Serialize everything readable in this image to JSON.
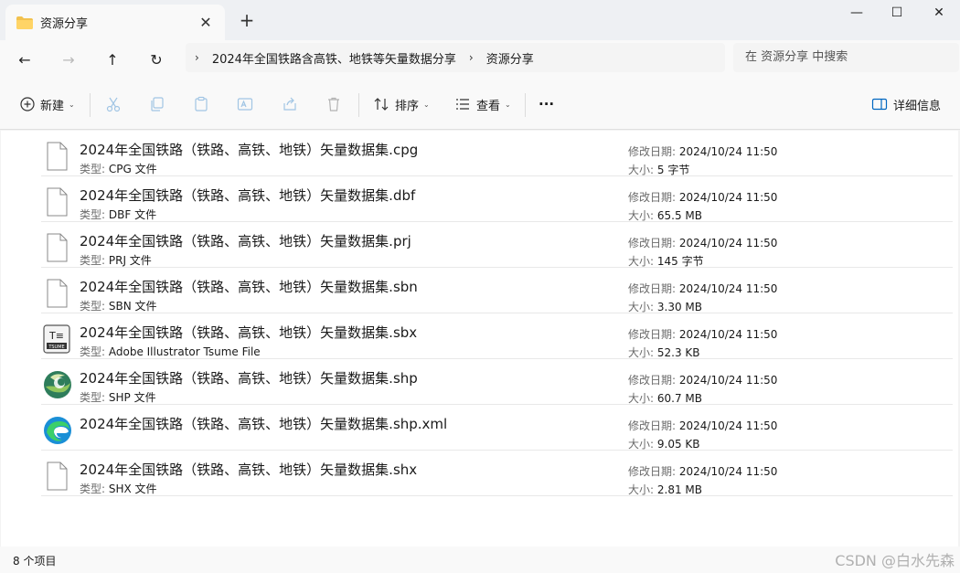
{
  "window": {
    "tab_title": "资源分享",
    "tab_close": "✕",
    "new_tab": "+",
    "minimize": "—",
    "maximize": "☐",
    "close": "✕"
  },
  "nav": {
    "back": "←",
    "forward": "→",
    "up": "↑",
    "refresh": "↻"
  },
  "address": {
    "chevron": "›",
    "breadcrumbs": [
      "2024年全国铁路含高铁、地铁等矢量数据分享",
      "资源分享"
    ]
  },
  "search": {
    "placeholder": "在 资源分享 中搜索"
  },
  "toolbar": {
    "new_label": "新建",
    "sort_label": "排序",
    "view_label": "查看",
    "more_label": "···",
    "details_label": "详细信息",
    "chevron": "⌄"
  },
  "files": [
    {
      "name": "2024年全国铁路（铁路、高铁、地铁）矢量数据集.cpg",
      "type_key": "类型:",
      "type": "CPG 文件",
      "icon": "generic-file-icon",
      "date_key": "修改日期:",
      "date": "2024/10/24 11:50",
      "size_key": "大小:",
      "size": "5 字节"
    },
    {
      "name": "2024年全国铁路（铁路、高铁、地铁）矢量数据集.dbf",
      "type_key": "类型:",
      "type": "DBF 文件",
      "icon": "generic-file-icon",
      "date_key": "修改日期:",
      "date": "2024/10/24 11:50",
      "size_key": "大小:",
      "size": "65.5 MB"
    },
    {
      "name": "2024年全国铁路（铁路、高铁、地铁）矢量数据集.prj",
      "type_key": "类型:",
      "type": "PRJ 文件",
      "icon": "generic-file-icon",
      "date_key": "修改日期:",
      "date": "2024/10/24 11:50",
      "size_key": "大小:",
      "size": "145 字节"
    },
    {
      "name": "2024年全国铁路（铁路、高铁、地铁）矢量数据集.sbn",
      "type_key": "类型:",
      "type": "SBN 文件",
      "icon": "generic-file-icon",
      "date_key": "修改日期:",
      "date": "2024/10/24 11:50",
      "size_key": "大小:",
      "size": "3.30 MB"
    },
    {
      "name": "2024年全国铁路（铁路、高铁、地铁）矢量数据集.sbx",
      "type_key": "类型:",
      "type": "Adobe Illustrator Tsume File",
      "icon": "tsume-file-icon",
      "date_key": "修改日期:",
      "date": "2024/10/24 11:50",
      "size_key": "大小:",
      "size": "52.3 KB"
    },
    {
      "name": "2024年全国铁路（铁路、高铁、地铁）矢量数据集.shp",
      "type_key": "类型:",
      "type": "SHP 文件",
      "icon": "globe-file-icon",
      "date_key": "修改日期:",
      "date": "2024/10/24 11:50",
      "size_key": "大小:",
      "size": "60.7 MB"
    },
    {
      "name": "2024年全国铁路（铁路、高铁、地铁）矢量数据集.shp.xml",
      "type_key": "",
      "type": "",
      "icon": "edge-browser-icon",
      "date_key": "修改日期:",
      "date": "2024/10/24 11:50",
      "size_key": "大小:",
      "size": "9.05 KB"
    },
    {
      "name": "2024年全国铁路（铁路、高铁、地铁）矢量数据集.shx",
      "type_key": "类型:",
      "type": "SHX 文件",
      "icon": "generic-file-icon",
      "date_key": "修改日期:",
      "date": "2024/10/24 11:50",
      "size_key": "大小:",
      "size": "2.81 MB"
    }
  ],
  "tsume_icon_text": "T≡ TSUME",
  "status": {
    "count": "8 个项目"
  },
  "watermark": "CSDN @白水先森",
  "colors": {
    "accent": "#0067c0",
    "folder": "#f2c14e"
  }
}
